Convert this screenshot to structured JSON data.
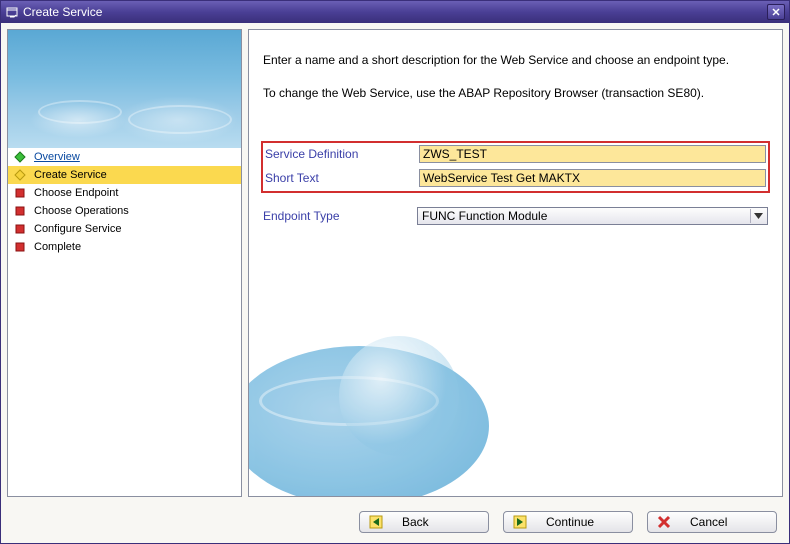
{
  "window": {
    "title": "Create Service"
  },
  "steps": {
    "overview": "Overview",
    "create_service": "Create Service",
    "choose_endpoint": "Choose Endpoint",
    "choose_operations": "Choose Operations",
    "configure_service": "Configure Service",
    "complete": "Complete"
  },
  "instructions": {
    "p1": "Enter a name and a short description for the Web Service and choose an endpoint type.",
    "p2": "To change the Web Service, use the ABAP Repository Browser (transaction SE80)."
  },
  "form": {
    "service_definition_label": "Service Definition",
    "service_definition_value": "ZWS_TEST",
    "short_text_label": "Short Text",
    "short_text_value": "WebService Test Get MAKTX",
    "endpoint_type_label": "Endpoint Type",
    "endpoint_type_value": "FUNC Function Module"
  },
  "buttons": {
    "back": "Back",
    "continue": "Continue",
    "cancel": "Cancel"
  }
}
